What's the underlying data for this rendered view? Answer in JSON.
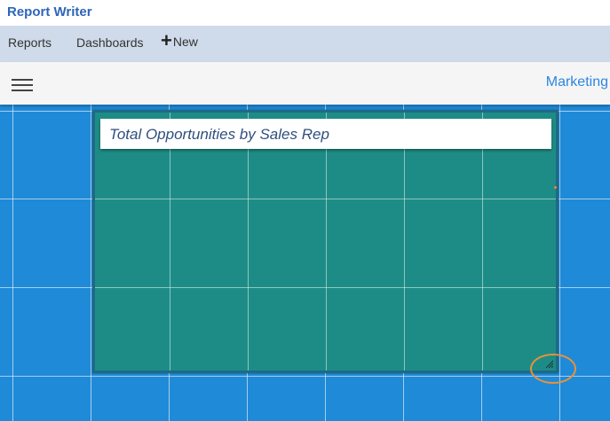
{
  "app": {
    "title": "Report Writer"
  },
  "menu": {
    "reports_label": "Reports",
    "dashboards_label": "Dashboards",
    "new_label": "New"
  },
  "toolbar": {
    "dashboard_name": "Marketing"
  },
  "widget": {
    "title": "Total Opportunities by Sales Rep"
  },
  "colors": {
    "brand": "#2e66b8",
    "menubar": "#cfdaea",
    "canvas": "#1f8ad8",
    "widget": "#1e8c86",
    "highlight": "#e8913a"
  },
  "icons": [
    "plus-icon",
    "caret-down-icon",
    "hamburger-icon",
    "resize-handle-icon"
  ]
}
